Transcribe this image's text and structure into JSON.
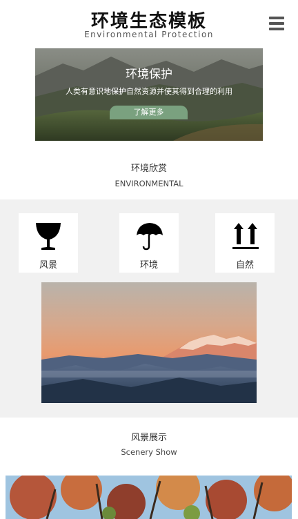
{
  "header": {
    "title": "环境生态模板",
    "subtitle": "Environmental Protection",
    "menu_icon": "hamburger-icon"
  },
  "banner": {
    "title": "环境保护",
    "text": "人类有意识地保护自然资源并使其得到合理的利用",
    "button_label": "了解更多"
  },
  "section1": {
    "title": "环境欣赏",
    "subtitle": "ENVIRONMENTAL"
  },
  "features": [
    {
      "label": "风景",
      "icon": "wine-glass-icon"
    },
    {
      "label": "环境",
      "icon": "umbrella-icon"
    },
    {
      "label": "自然",
      "icon": "arrows-up-icon"
    }
  ],
  "section2": {
    "title": "风景展示",
    "subtitle": "Scenery Show"
  },
  "colors": {
    "button_green": "#7aa17f",
    "gray_bg": "#f1f1f1",
    "menu_icon": "#555555"
  }
}
